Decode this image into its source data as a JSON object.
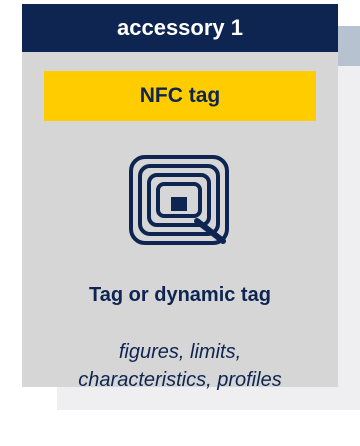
{
  "card": {
    "header_label": "accessory 1",
    "badge_label": "NFC tag",
    "icon": "nfc-tag-icon",
    "title": "Tag or dynamic tag",
    "description_lines": [
      "figures, limits,",
      "characteristics, profiles"
    ]
  },
  "colors": {
    "navy": "#0d2550",
    "yellow": "#ffcc00",
    "card_gray": "#d6d6d6"
  }
}
